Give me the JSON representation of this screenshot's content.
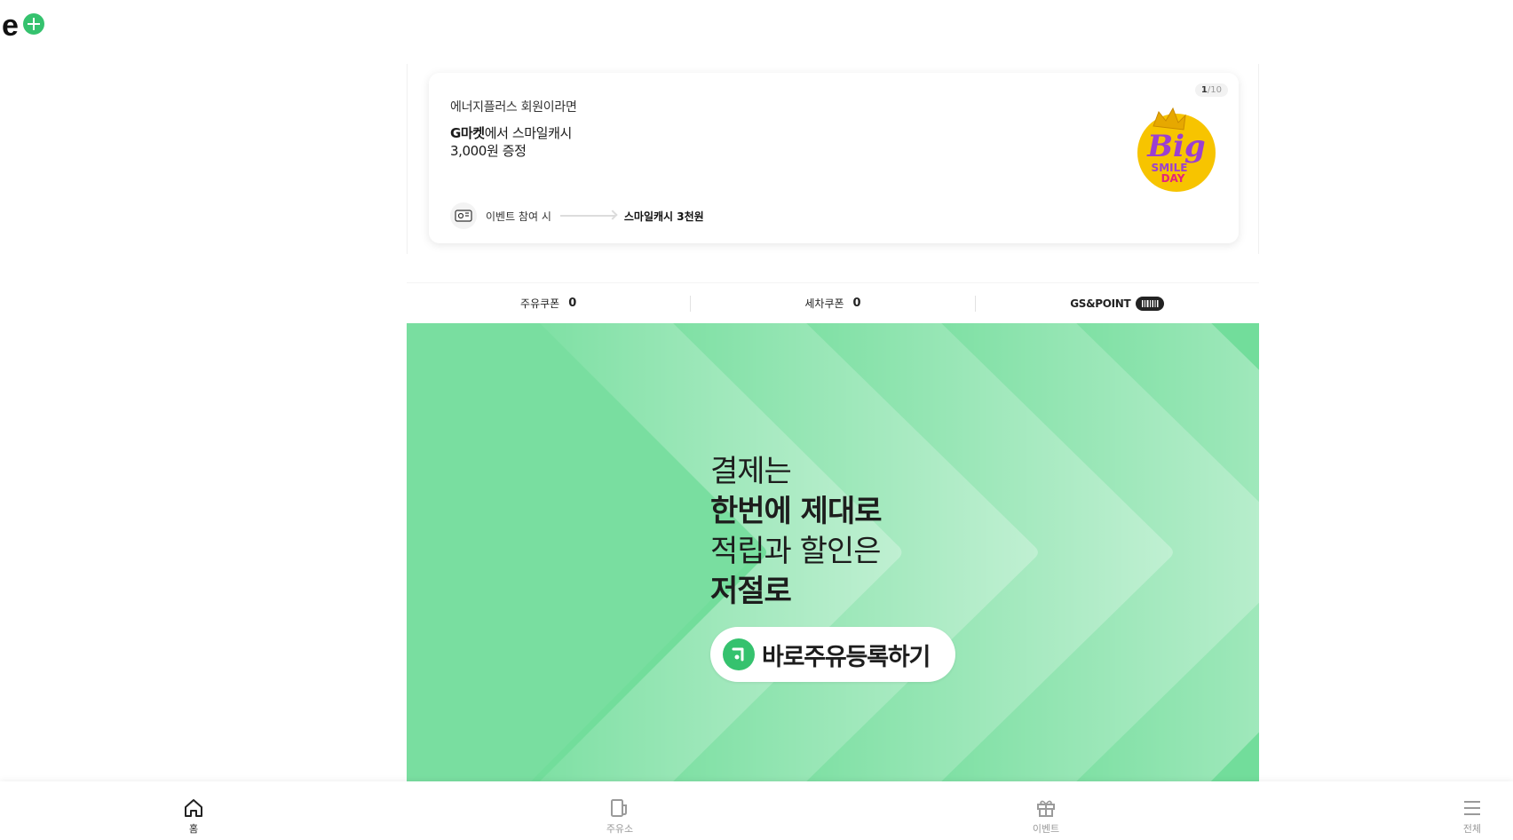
{
  "logo": {
    "icon": "eplus-logo",
    "accent": "#35c26e"
  },
  "banner": {
    "subtitle": "에너지플러스 회원이라면",
    "title_brand": "G마켓",
    "title_rest": "에서 스마일캐시",
    "title_line2": "3,000원 증정",
    "flow_step": "이벤트 참여 시",
    "flow_reward": "스마일캐시 3천원",
    "pager_current": "1",
    "pager_sep": "/",
    "pager_total": "10",
    "badge_big": "Big",
    "badge_smile": "SMILE",
    "badge_day": "DAY"
  },
  "coupons": {
    "fuel_label": "주유쿠폰",
    "fuel_count": "0",
    "wash_label": "세차쿠폰",
    "wash_count": "0",
    "point_label": "GS&POINT"
  },
  "promo": {
    "line1": "결제는",
    "line2": "한번에 제대로",
    "line3": "적립과 할인은",
    "line4": "저절로",
    "button_label": "바로주유등록하기",
    "bg_color": "#72dd9b"
  },
  "nav": {
    "items": [
      {
        "label": "홈",
        "icon": "home-icon",
        "active": true
      },
      {
        "label": "주유소",
        "icon": "gas-station-icon",
        "active": false
      },
      {
        "label": "이벤트",
        "icon": "gift-icon",
        "active": false
      },
      {
        "label": "전체",
        "icon": "menu-icon",
        "active": false
      }
    ]
  }
}
